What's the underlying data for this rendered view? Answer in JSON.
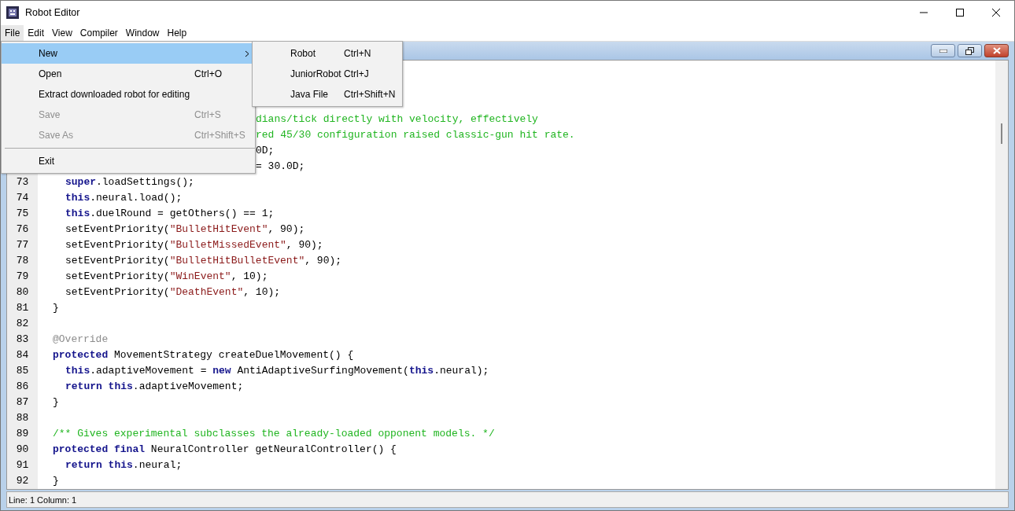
{
  "window": {
    "title": "Robot Editor"
  },
  "menu_bar": [
    {
      "label": "File",
      "selected": true
    },
    {
      "label": "Edit",
      "selected": false
    },
    {
      "label": "View",
      "selected": false
    },
    {
      "label": "Compiler",
      "selected": false
    },
    {
      "label": "Window",
      "selected": false
    },
    {
      "label": "Help",
      "selected": false
    }
  ],
  "file_menu": [
    {
      "kind": "submenu",
      "label": "New",
      "selected": true,
      "disabled": false
    },
    {
      "kind": "item",
      "label": "Open",
      "shortcut": "Ctrl+O",
      "selected": false,
      "disabled": false
    },
    {
      "kind": "item",
      "label": "Extract downloaded robot for editing",
      "selected": false,
      "disabled": false
    },
    {
      "kind": "item",
      "label": "Save",
      "shortcut": "Ctrl+S",
      "selected": false,
      "disabled": true
    },
    {
      "kind": "item",
      "label": "Save As",
      "shortcut": "Ctrl+Shift+S",
      "selected": false,
      "disabled": true
    },
    {
      "kind": "separator"
    },
    {
      "kind": "item",
      "label": "Exit",
      "selected": false,
      "disabled": false
    }
  ],
  "new_submenu": [
    {
      "label": "Robot",
      "shortcut": "Ctrl+N"
    },
    {
      "label": "JuniorRobot",
      "shortcut": "Ctrl+J"
    },
    {
      "label": "Java File",
      "shortcut": "Ctrl+Shift+N"
    }
  ],
  "editor": {
    "lines": [
      {
        "kind": "partial",
        "tokens": [
          {
            "kind": "comment",
            "text": "dians/tick directly with velocity, effectively"
          }
        ]
      },
      {
        "kind": "partial",
        "tokens": [
          {
            "kind": "comment",
            "text": "red 45/30 configuration raised classic-gun hit rate."
          }
        ]
      },
      {
        "kind": "partial",
        "tokens": [
          {
            "kind": "plain",
            "text": "0D;"
          }
        ]
      },
      {
        "kind": "partial",
        "tokens": [
          {
            "kind": "plain",
            "text": "= 30.0D;"
          }
        ]
      },
      {
        "kind": "full",
        "number": "73",
        "indent": true,
        "tokens": [
          {
            "kind": "keyword",
            "text": "super"
          },
          {
            "kind": "plain",
            "text": ".loadSettings();"
          }
        ]
      },
      {
        "kind": "full",
        "number": "74",
        "indent": true,
        "tokens": [
          {
            "kind": "keyword",
            "text": "this"
          },
          {
            "kind": "plain",
            "text": ".neural.load();"
          }
        ]
      },
      {
        "kind": "full",
        "number": "75",
        "indent": true,
        "tokens": [
          {
            "kind": "keyword",
            "text": "this"
          },
          {
            "kind": "plain",
            "text": ".duelRound = getOthers() == 1;"
          }
        ]
      },
      {
        "kind": "full",
        "number": "76",
        "indent": true,
        "tokens": [
          {
            "kind": "plain",
            "text": "setEventPriority("
          },
          {
            "kind": "string",
            "text": "\"BulletHitEvent\""
          },
          {
            "kind": "plain",
            "text": ", 90);"
          }
        ]
      },
      {
        "kind": "full",
        "number": "77",
        "indent": true,
        "tokens": [
          {
            "kind": "plain",
            "text": "setEventPriority("
          },
          {
            "kind": "string",
            "text": "\"BulletMissedEvent\""
          },
          {
            "kind": "plain",
            "text": ", 90);"
          }
        ]
      },
      {
        "kind": "full",
        "number": "78",
        "indent": true,
        "tokens": [
          {
            "kind": "plain",
            "text": "setEventPriority("
          },
          {
            "kind": "string",
            "text": "\"BulletHitBulletEvent\""
          },
          {
            "kind": "plain",
            "text": ", 90);"
          }
        ]
      },
      {
        "kind": "full",
        "number": "79",
        "indent": true,
        "tokens": [
          {
            "kind": "plain",
            "text": "setEventPriority("
          },
          {
            "kind": "string",
            "text": "\"WinEvent\""
          },
          {
            "kind": "plain",
            "text": ", 10);"
          }
        ]
      },
      {
        "kind": "full",
        "number": "80",
        "indent": true,
        "tokens": [
          {
            "kind": "plain",
            "text": "setEventPriority("
          },
          {
            "kind": "string",
            "text": "\"DeathEvent\""
          },
          {
            "kind": "plain",
            "text": ", 10);"
          }
        ]
      },
      {
        "kind": "full",
        "number": "81",
        "indent": false,
        "tokens": [
          {
            "kind": "plain",
            "text": "}"
          }
        ]
      },
      {
        "kind": "full",
        "number": "82"
      },
      {
        "kind": "full",
        "number": "83",
        "indent": false,
        "tokens": [
          {
            "kind": "annotation",
            "text": "@Override"
          }
        ]
      },
      {
        "kind": "full",
        "number": "84",
        "indent": false,
        "tokens": [
          {
            "kind": "keyword",
            "text": "protected"
          },
          {
            "kind": "plain",
            "text": " MovementStrategy createDuelMovement() {"
          }
        ]
      },
      {
        "kind": "full",
        "number": "85",
        "indent": true,
        "tokens": [
          {
            "kind": "keyword",
            "text": "this"
          },
          {
            "kind": "plain",
            "text": ".adaptiveMovement = "
          },
          {
            "kind": "keyword",
            "text": "new"
          },
          {
            "kind": "plain",
            "text": " AntiAdaptiveSurfingMovement("
          },
          {
            "kind": "keyword",
            "text": "this"
          },
          {
            "kind": "plain",
            "text": ".neural);"
          }
        ]
      },
      {
        "kind": "full",
        "number": "86",
        "indent": true,
        "tokens": [
          {
            "kind": "keyword",
            "text": "return"
          },
          {
            "kind": "keyword",
            "text": " this"
          },
          {
            "kind": "plain",
            "text": ".adaptiveMovement;"
          }
        ]
      },
      {
        "kind": "full",
        "number": "87",
        "indent": false,
        "tokens": [
          {
            "kind": "plain",
            "text": "}"
          }
        ]
      },
      {
        "kind": "full",
        "number": "88"
      },
      {
        "kind": "full",
        "number": "89",
        "indent": false,
        "tokens": [
          {
            "kind": "comment",
            "text": "/** Gives experimental subclasses the already-loaded opponent models. */"
          }
        ]
      },
      {
        "kind": "full",
        "number": "90",
        "indent": false,
        "tokens": [
          {
            "kind": "keyword",
            "text": "protected"
          },
          {
            "kind": "keyword",
            "text": " final"
          },
          {
            "kind": "plain",
            "text": " NeuralController getNeuralController() {"
          }
        ]
      },
      {
        "kind": "full",
        "number": "91",
        "indent": true,
        "tokens": [
          {
            "kind": "keyword",
            "text": "return"
          },
          {
            "kind": "keyword",
            "text": " this"
          },
          {
            "kind": "plain",
            "text": ".neural;"
          }
        ]
      },
      {
        "kind": "full",
        "number": "92",
        "indent": false,
        "tokens": [
          {
            "kind": "plain",
            "text": "}"
          }
        ]
      }
    ]
  },
  "status_bar": "Line: 1 Column: 1"
}
